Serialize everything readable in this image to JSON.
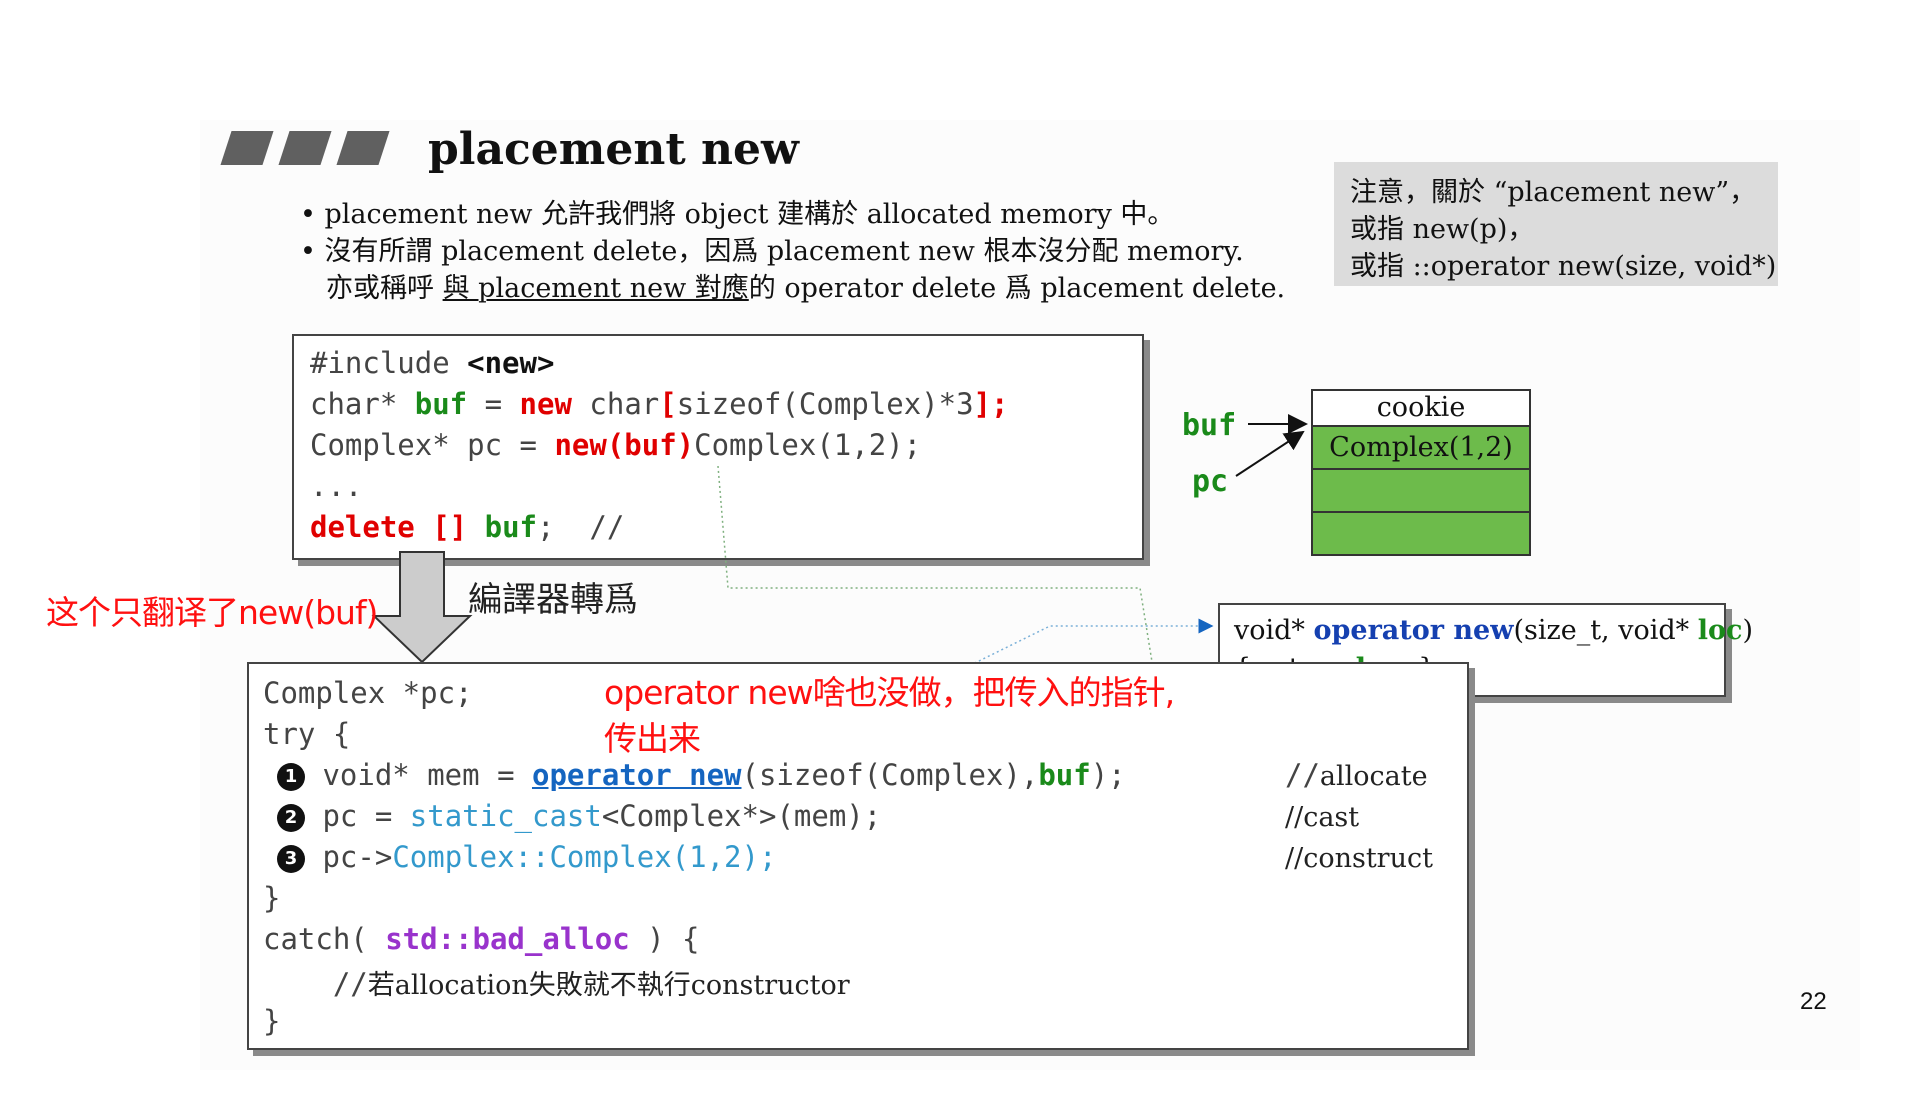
{
  "title": "placement new",
  "bullets": {
    "b1": "• placement new 允許我們將 object 建構於 allocated memory 中。",
    "b2": "• 沒有所謂 placement delete，因爲 placement new 根本沒分配 memory.",
    "b3_pre": "亦或稱呼 ",
    "b3_u": "與 placement new 對應",
    "b3_post": "的 operator delete 爲 placement delete."
  },
  "note": {
    "l1": "注意，關於 “placement new”，",
    "l2": "或指 new(p)，",
    "l3": "或指 ::operator new(size, void*)"
  },
  "code1": {
    "l1a": "#include ",
    "l1b": "<new>",
    "l2a": "char* ",
    "l2b": "buf",
    "l2c": " = ",
    "l2d": "new",
    "l2e": " char",
    "l2f": "[",
    "l2g": "sizeof(Complex)*3",
    "l2h": "];",
    "l3a": "Complex* pc = ",
    "l3b": "new(buf)",
    "l3c": "Complex(1,2);",
    "l4": "...",
    "l5a": "delete [] ",
    "l5b": "buf",
    "l5c": ";  //"
  },
  "compiler_label": "編譯器轉爲",
  "annotations": {
    "a1": "这个只翻译了new(buf)",
    "a2_l1": "operator new啥也没做，把传入的指针,",
    "a2_l2": "传出来"
  },
  "memory": {
    "cookie": "cookie",
    "cell1": "Complex(1,2)",
    "buf_label": "buf",
    "pc_label": "pc"
  },
  "op_box": {
    "l1a": "void* ",
    "l1b": "operator new",
    "l1c": "(size_t, void* ",
    "l1d": "loc",
    "l1e": ")",
    "l2a": "{ return ",
    "l2b": "loc",
    "l2c": ";  }"
  },
  "code2": {
    "l1": "Complex *pc;",
    "l2": "try {",
    "n1": "1",
    "l3a": "void* mem = ",
    "l3b": "operator new",
    "l3c": "(sizeof(Complex),",
    "l3d": "buf",
    "l3e": ");",
    "c3": "//allocate",
    "n2": "2",
    "l4a": "pc = ",
    "l4b": "static_cast",
    "l4c": "<Complex*>(mem);",
    "c4": "//cast",
    "n3": "3",
    "l5a": "pc->",
    "l5b": "Complex::Complex(1,2);",
    "c5": "//construct",
    "l6": "}",
    "l7a": "catch( ",
    "l7b": "std::bad_alloc",
    "l7c": " ) {",
    "l8a": "    //",
    "l8b": "若allocation失敗就不執行constructor",
    "l9": "}"
  },
  "page_number": "22"
}
